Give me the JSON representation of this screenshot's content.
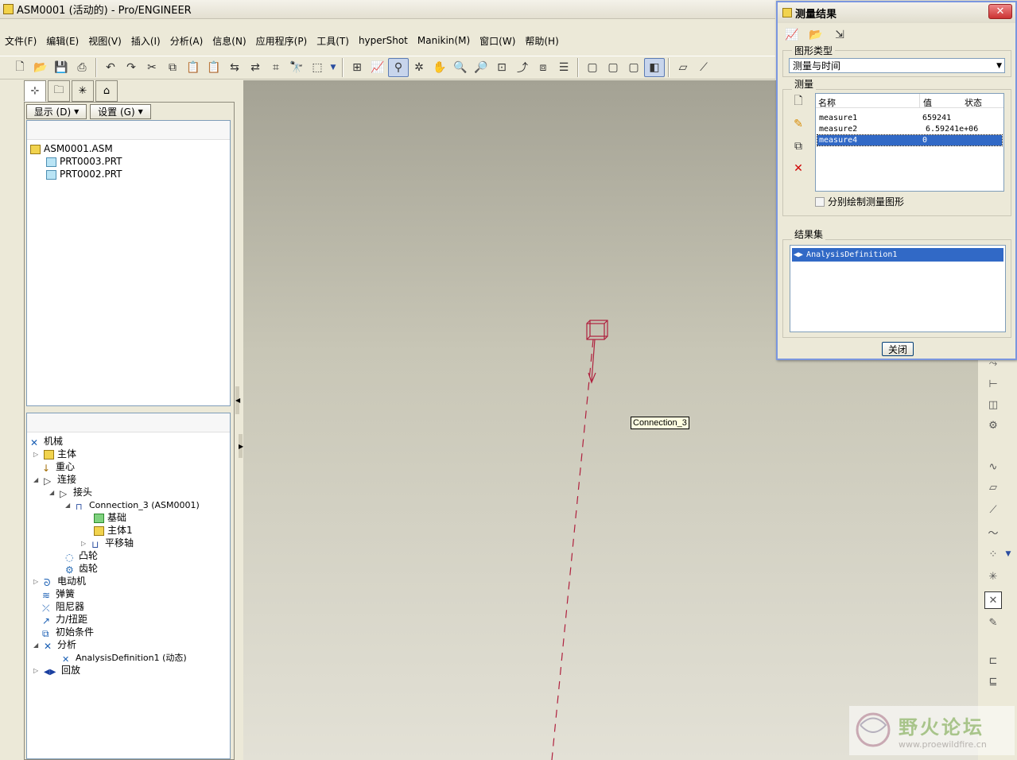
{
  "window": {
    "title": "ASM0001 (活动的) - Pro/ENGINEER"
  },
  "menu": [
    "文件(F)",
    "编辑(E)",
    "视图(V)",
    "插入(I)",
    "分析(A)",
    "信息(N)",
    "应用程序(P)",
    "工具(T)",
    "hyperShot",
    "Manikin(M)",
    "窗口(W)",
    "帮助(H)"
  ],
  "nav": {
    "show_label": "显示 (D)",
    "settings_label": "设置 (G)",
    "model_tree": [
      "ASM0001.ASM",
      "PRT0003.PRT",
      "PRT0002.PRT"
    ],
    "mech_tree": {
      "root": "机械",
      "bodies": "主体",
      "gravity": "重心",
      "connections": "连接",
      "joints": "接头",
      "connection": "Connection_3 (ASM0001)",
      "ground": "基础",
      "body1": "主体1",
      "translation_axis": "平移轴",
      "cams": "凸轮",
      "gears": "齿轮",
      "motors": "电动机",
      "springs": "弹簧",
      "dampers": "阻尼器",
      "force_torque": "力/扭距",
      "initial_conditions": "初始条件",
      "analyses": "分析",
      "analysis_def": "AnalysisDefinition1 (动态)",
      "playbacks": "回放"
    }
  },
  "viewport": {
    "tooltip": "Connection_3"
  },
  "dialog": {
    "title": "测量结果",
    "graph_type_label": "图形类型",
    "graph_type_value": "测量与时间",
    "measures_label": "测量",
    "columns": [
      "名称",
      "值",
      "状态"
    ],
    "measures": [
      {
        "name": "measure1",
        "value": "659241",
        "status": ""
      },
      {
        "name": "measure2",
        "value": "6.59241e+06",
        "status": ""
      },
      {
        "name": "measure4",
        "value": "0",
        "status": ""
      }
    ],
    "separate_plot_label": "分别绘制测量图形",
    "result_set_label": "结果集",
    "result_sets": [
      "AnalysisDefinition1"
    ],
    "close_label": "关闭"
  },
  "watermark": {
    "title": "野火论坛",
    "url": "www.proewildfire.cn"
  }
}
